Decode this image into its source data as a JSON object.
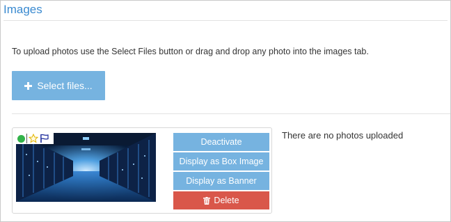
{
  "panel": {
    "title": "Images",
    "hint": "To upload photos use the Select Files button or drag and drop any photo into the images tab.",
    "select_files_label": "Select files..."
  },
  "image_card": {
    "thumbnail": "server-room-photo",
    "status_icons": [
      "active-status-dot",
      "star-icon",
      "flag-icon"
    ],
    "actions": {
      "deactivate": "Deactivate",
      "box_image": "Display as Box Image",
      "banner": "Display as Banner",
      "delete": "Delete"
    }
  },
  "empty_message": "There are no photos uploaded",
  "colors": {
    "accent_blue": "#76b3e0",
    "title_blue": "#3a8ad0",
    "danger_red": "#d9574a",
    "status_green": "#33b34a"
  }
}
